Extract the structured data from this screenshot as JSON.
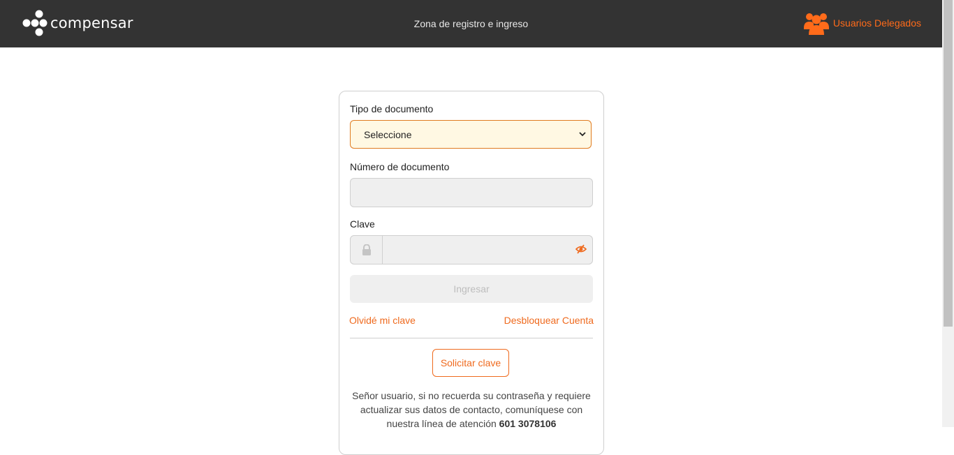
{
  "header": {
    "brand": "compensar",
    "title": "Zona de registro e ingreso",
    "delegados_label": "Usuarios Delegados",
    "delegados_icon": "users-group-icon"
  },
  "form": {
    "tipo_label": "Tipo de documento",
    "tipo_value": "Seleccione",
    "numero_label": "Número de documento",
    "numero_value": "",
    "clave_label": "Clave",
    "clave_value": "",
    "ingresar_label": "Ingresar",
    "olvide_label": "Olvidé mi clave",
    "desbloquear_label": "Desbloquear Cuenta",
    "solicitar_label": "Solicitar clave",
    "info_text": "Señor usuario, si no recuerda su contraseña y requiere actualizar sus datos de contacto, comuníquese con nuestra línea de atención",
    "info_phone": "601 3078106"
  },
  "colors": {
    "header_bg": "#333333",
    "accent": "#ef6a1e",
    "select_bg": "#fff8e3",
    "input_bg": "#efefef"
  }
}
